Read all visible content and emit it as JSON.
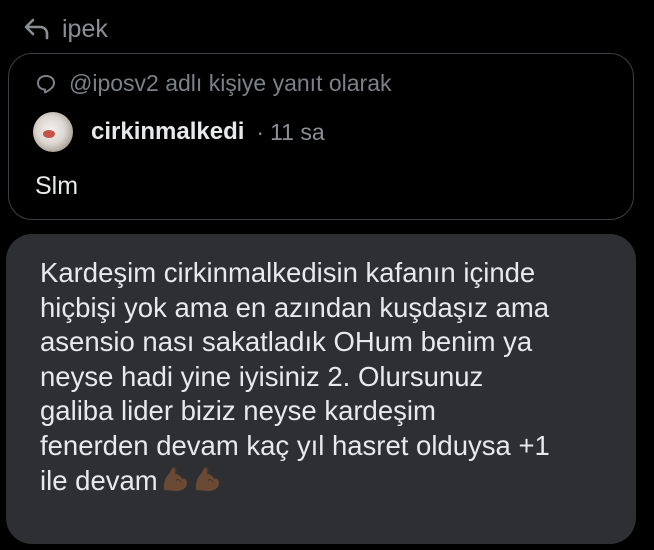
{
  "reply_header": {
    "icon": "reply-arrow-icon",
    "name": "ipek"
  },
  "quoted_tweet": {
    "context_icon": "speech-bubble-icon",
    "context_text": "@iposv2 adlı kişiye yanıt olarak",
    "author": {
      "avatar": "cat-avatar",
      "name": "cirkinmalkedi",
      "separator": "·",
      "time": "11 sa"
    },
    "text": "Slm"
  },
  "message": {
    "text": "Kardeşim cirkinmalkedisin kafanın içinde\nhiçbişi yok ama en azından kuşdaşız ama\nasensio nası sakatladık OHum benim ya\nneyse hadi yine iyisiniz 2. Olursunuz\ngaliba lider biziz neyse kardeşim\nfenerden devam kaç yıl hasret olduysa +1\nile devam",
    "emojis": [
      "flexed-biceps-icon",
      "flexed-biceps-icon"
    ]
  },
  "colors": {
    "background": "#000000",
    "bubble": "#2e2f33",
    "muted_text": "#8b8f94",
    "primary_text": "#e7e9ea",
    "border": "#3b3e42"
  }
}
